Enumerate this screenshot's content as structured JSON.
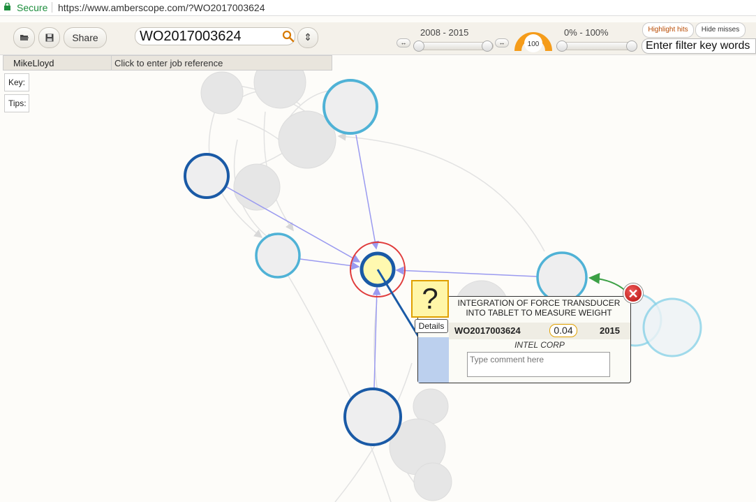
{
  "browser": {
    "secure_label": "Secure",
    "url": "https://www.amberscope.com/?WO2017003624"
  },
  "toolbar": {
    "share_label": "Share",
    "search_value": "WO2017003624",
    "year_range": "2008 - 2015",
    "percent_range": "0% - 100%",
    "gauge_value": "100",
    "gauge_color": "#f59c1a",
    "stepper_glyph": "⇕",
    "range_step_glyph": "↔",
    "highlight_hits_label": "Highlight hits",
    "hide_misses_label": "Hide misses",
    "filter_placeholder": "Enter filter key words"
  },
  "userbar": {
    "user": "MikeLloyd",
    "job_reference": "Click to enter job reference"
  },
  "side_tabs": {
    "key_label": "Key:",
    "tips_label": "Tips:"
  },
  "popup": {
    "question_mark": "?",
    "details_label": "Details",
    "title": "INTEGRATION OF FORCE TRANSDUCER INTO TABLET TO MEASURE WEIGHT",
    "patent_number": "WO2017003624",
    "score": "0.04",
    "year": "2015",
    "company": "INTEL CORP",
    "comment_placeholder": "Type comment here",
    "close_glyph": "✕"
  },
  "graph_colors": {
    "dark_node": "#1a5aa6",
    "light_node": "#4fb2d6",
    "focus_ring": "#e03b3b",
    "focus_fill": "#fff9b0",
    "link": "#9a9af0",
    "green_link": "#3ca045",
    "ghost_node": "#e6e6e6"
  }
}
